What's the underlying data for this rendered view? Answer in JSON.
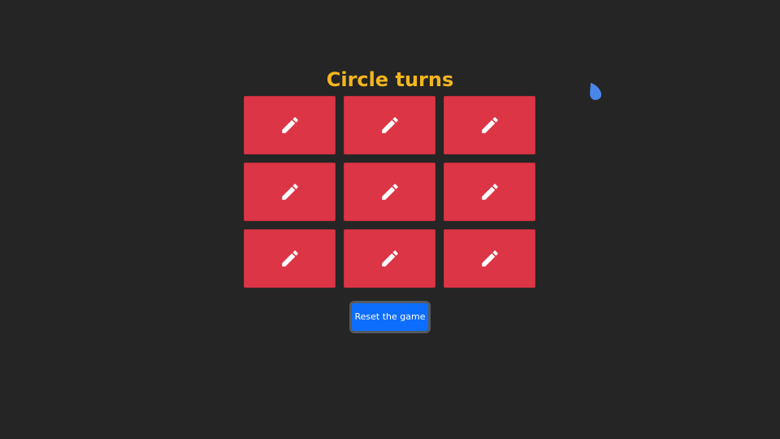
{
  "game": {
    "status_text": "Circle turns",
    "reset_label": "Reset the game"
  },
  "board": {
    "cells": [
      {
        "row": 1,
        "col": 1,
        "icon": "pencil-icon"
      },
      {
        "row": 1,
        "col": 2,
        "icon": "pencil-icon"
      },
      {
        "row": 1,
        "col": 3,
        "icon": "pencil-icon"
      },
      {
        "row": 2,
        "col": 1,
        "icon": "pencil-icon"
      },
      {
        "row": 2,
        "col": 2,
        "icon": "pencil-icon"
      },
      {
        "row": 2,
        "col": 3,
        "icon": "pencil-icon"
      },
      {
        "row": 3,
        "col": 1,
        "icon": "pencil-icon"
      },
      {
        "row": 3,
        "col": 2,
        "icon": "pencil-icon"
      },
      {
        "row": 3,
        "col": 3,
        "icon": "pencil-icon"
      }
    ]
  },
  "colors": {
    "background": "#252525",
    "title": "#f3b61e",
    "cell": "#dc3545",
    "button": "#0d6efd",
    "marker": "#4a86e8"
  },
  "overlay": {
    "icon": "droplet-icon"
  }
}
